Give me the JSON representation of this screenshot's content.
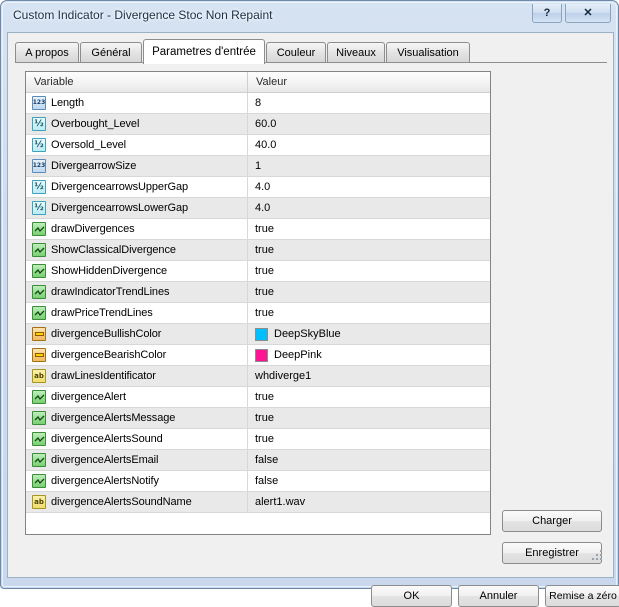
{
  "window": {
    "title": "Custom Indicator - Divergence Stoc Non Repaint",
    "help_glyph": "?",
    "close_glyph": "✕",
    "help_name": "help-button",
    "close_name": "close-button"
  },
  "tabs": [
    {
      "label": "A propos",
      "active": false
    },
    {
      "label": "Général",
      "active": false
    },
    {
      "label": "Parametres d'entrée",
      "active": true
    },
    {
      "label": "Couleur",
      "active": false
    },
    {
      "label": "Niveaux",
      "active": false
    },
    {
      "label": "Visualisation",
      "active": false
    }
  ],
  "grid": {
    "columns": [
      "Variable",
      "Valeur"
    ],
    "rows": [
      {
        "icon": "int-icon",
        "type": "int",
        "name": "Length",
        "value": "8"
      },
      {
        "icon": "double-icon",
        "type": "dbl",
        "name": "Overbought_Level",
        "value": "60.0"
      },
      {
        "icon": "double-icon",
        "type": "dbl",
        "name": "Oversold_Level",
        "value": "40.0"
      },
      {
        "icon": "int-icon",
        "type": "int",
        "name": "DivergearrowSize",
        "value": "1"
      },
      {
        "icon": "double-icon",
        "type": "dbl",
        "name": "DivergencearrowsUpperGap",
        "value": "4.0"
      },
      {
        "icon": "double-icon",
        "type": "dbl",
        "name": "DivergencearrowsLowerGap",
        "value": "4.0"
      },
      {
        "icon": "bool-icon",
        "type": "bool",
        "name": "drawDivergences",
        "value": "true"
      },
      {
        "icon": "bool-icon",
        "type": "bool",
        "name": "ShowClassicalDivergence",
        "value": "true"
      },
      {
        "icon": "bool-icon",
        "type": "bool",
        "name": "ShowHiddenDivergence",
        "value": "true"
      },
      {
        "icon": "bool-icon",
        "type": "bool",
        "name": "drawIndicatorTrendLines",
        "value": "true"
      },
      {
        "icon": "bool-icon",
        "type": "bool",
        "name": "drawPriceTrendLines",
        "value": "true"
      },
      {
        "icon": "color-icon",
        "type": "color",
        "name": "divergenceBullishColor",
        "value": "DeepSkyBlue",
        "swatch": "#00BFFF"
      },
      {
        "icon": "color-icon",
        "type": "color",
        "name": "divergenceBearishColor",
        "value": "DeepPink",
        "swatch": "#FF1493"
      },
      {
        "icon": "string-icon",
        "type": "str",
        "name": "drawLinesIdentificator",
        "value": "whdiverge1"
      },
      {
        "icon": "bool-icon",
        "type": "bool",
        "name": "divergenceAlert",
        "value": "true"
      },
      {
        "icon": "bool-icon",
        "type": "bool",
        "name": "divergenceAlertsMessage",
        "value": "true"
      },
      {
        "icon": "bool-icon",
        "type": "bool",
        "name": "divergenceAlertsSound",
        "value": "true"
      },
      {
        "icon": "bool-icon",
        "type": "bool",
        "name": "divergenceAlertsEmail",
        "value": "false"
      },
      {
        "icon": "bool-icon",
        "type": "bool",
        "name": "divergenceAlertsNotify",
        "value": "false"
      },
      {
        "icon": "string-icon",
        "type": "str",
        "name": "divergenceAlertsSoundName",
        "value": "alert1.wav"
      }
    ]
  },
  "side_buttons": {
    "load": "Charger",
    "save": "Enregistrer"
  },
  "dialog_buttons": {
    "ok": "OK",
    "cancel": "Annuler",
    "reset": "Remise a zéro"
  },
  "colors": {
    "deep_sky_blue": "#00BFFF",
    "deep_pink": "#FF1493",
    "title_text": "#1b2f48",
    "frame": "#6f89a8"
  }
}
